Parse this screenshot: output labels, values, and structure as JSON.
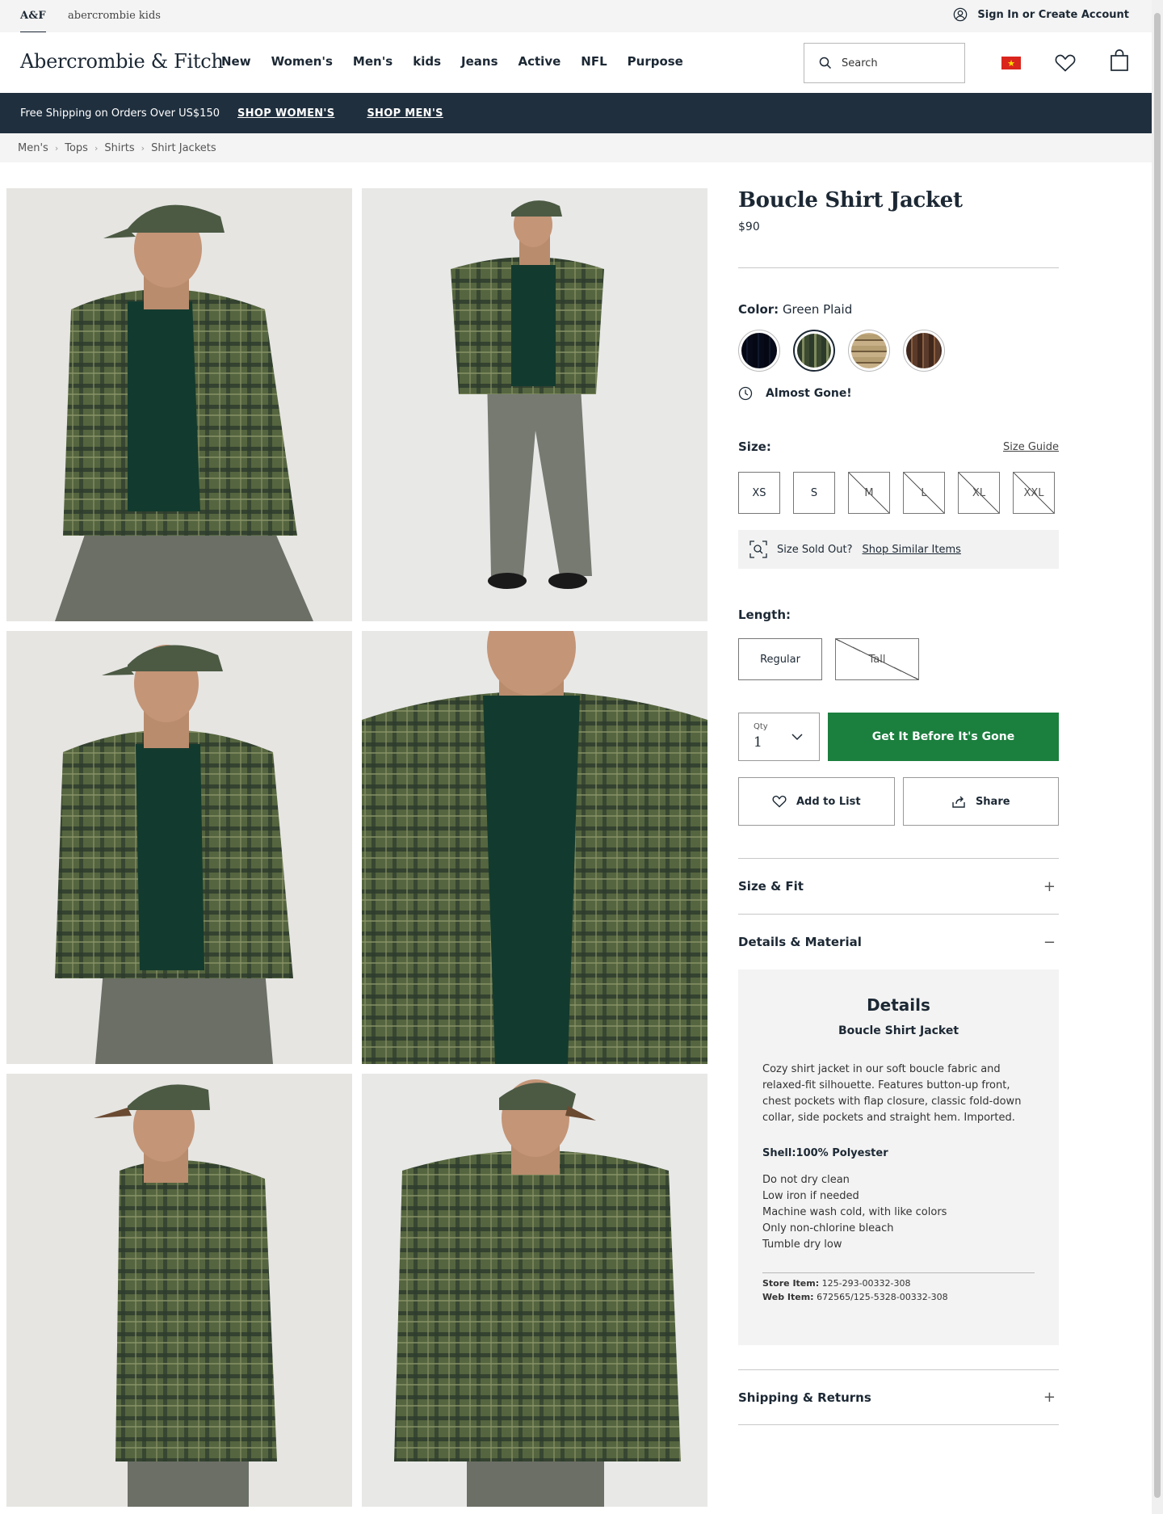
{
  "utility": {
    "af_tab": "A&F",
    "kids_tab": "abercrombie kids",
    "signin": "Sign In or Create Account"
  },
  "header": {
    "logo": "Abercrombie & Fitch",
    "nav": [
      "New",
      "Women's",
      "Men's",
      "kids",
      "Jeans",
      "Active",
      "NFL",
      "Purpose"
    ],
    "search_placeholder": "Search"
  },
  "promo": {
    "message": "Free Shipping on Orders Over US$150",
    "shop_women": "SHOP WOMEN'S",
    "shop_men": "SHOP MEN'S"
  },
  "breadcrumb": [
    "Men's",
    "Tops",
    "Shirts",
    "Shirt Jackets"
  ],
  "product": {
    "title": "Boucle Shirt Jacket",
    "price": "$90",
    "color_label": "Color:",
    "color_value": "Green Plaid",
    "swatches": [
      {
        "name": "Navy Plaid",
        "color": "#2a3550"
      },
      {
        "name": "Green Plaid",
        "color": "#3c4a32",
        "selected": true
      },
      {
        "name": "Tan Plaid",
        "color": "#b59e72"
      },
      {
        "name": "Brown Plaid",
        "color": "#5a3a2a"
      }
    ],
    "stock_status": "Almost Gone!",
    "size_label": "Size:",
    "size_guide": "Size Guide",
    "sizes": [
      {
        "label": "XS",
        "sold_out": false
      },
      {
        "label": "S",
        "sold_out": false
      },
      {
        "label": "M",
        "sold_out": true
      },
      {
        "label": "L",
        "sold_out": true
      },
      {
        "label": "XL",
        "sold_out": true
      },
      {
        "label": "XXL",
        "sold_out": true
      }
    ],
    "sold_out_text": "Size Sold Out?",
    "shop_similar": "Shop Similar Items",
    "length_label": "Length:",
    "lengths": [
      {
        "label": "Regular",
        "sold_out": false
      },
      {
        "label": "Tall",
        "sold_out": true
      }
    ],
    "qty_label": "Qty",
    "qty_value": "1",
    "buy_button": "Get It Before It's Gone",
    "add_to_list": "Add to List",
    "share": "Share"
  },
  "accordions": {
    "size_fit": "Size & Fit",
    "details_material": "Details & Material",
    "shipping_returns": "Shipping & Returns"
  },
  "details": {
    "heading": "Details",
    "subheading": "Boucle Shirt Jacket",
    "description": "Cozy shirt jacket in our soft boucle fabric and relaxed-fit silhouette. Features button-up front, chest pockets with flap closure, classic fold-down collar, side pockets and straight hem. Imported.",
    "fabric": "Shell:100% Polyester",
    "care": [
      "Do not dry clean",
      "Low iron if needed",
      "Machine wash cold, with like colors",
      "Only non-chlorine bleach",
      "Tumble dry low"
    ],
    "store_item_label": "Store Item:",
    "store_item": "125-293-00332-308",
    "web_item_label": "Web Item:",
    "web_item": "672565/125-5328-00332-308"
  },
  "colors": {
    "primary": "#1c2834",
    "promo_bg": "#1f2f3e",
    "buy": "#1b7f3e",
    "jacket": "#4a5a3a"
  }
}
